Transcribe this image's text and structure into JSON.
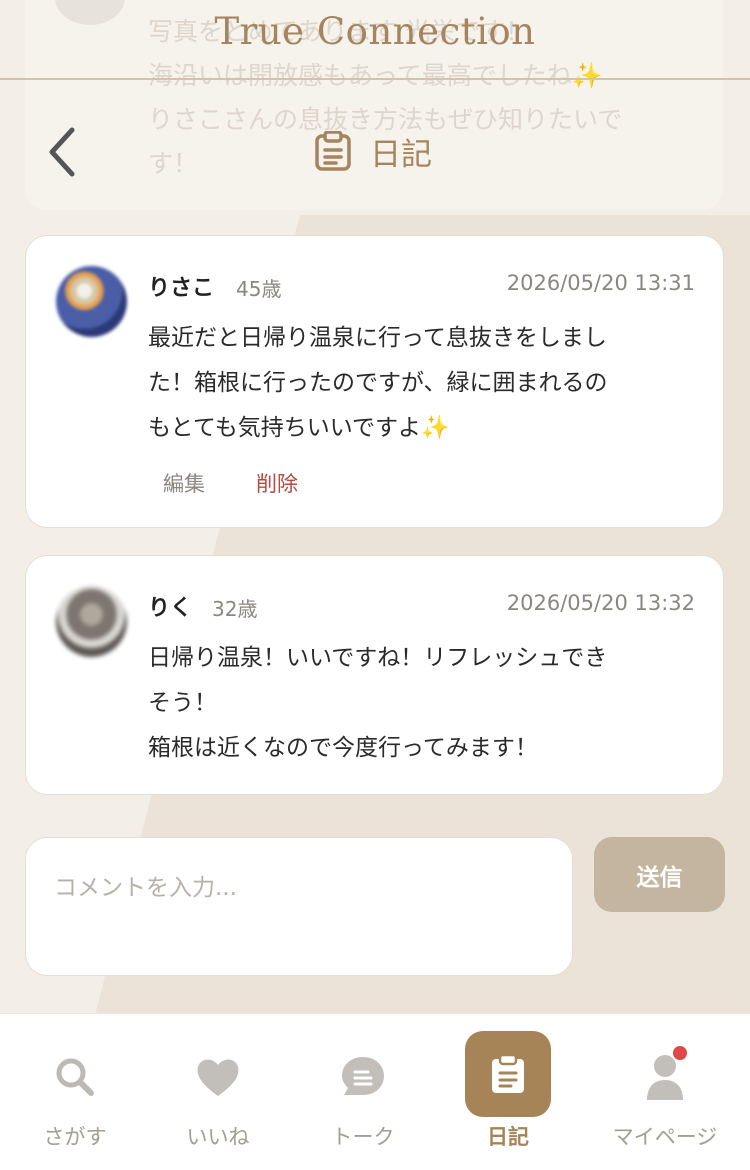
{
  "header": {
    "brand": "True Connection",
    "page_title": "日記"
  },
  "ghost_comment": {
    "text": "写真をとめてあります 光栄です！\n海沿いは開放感もあって最高でしたね✨\nりさこさんの息抜き方法もぜひ知りたいで\nす！"
  },
  "comments": [
    {
      "name": "りさこ",
      "age": "45歳",
      "timestamp": "2026/05/20 13:31",
      "text": "最近だと日帰り温泉に行って息抜きをしまし\nた！箱根に行ったのですが、緑に囲まれるの\nもとても気持ちいいですよ✨",
      "edit_label": "編集",
      "delete_label": "削除"
    },
    {
      "name": "りく",
      "age": "32歳",
      "timestamp": "2026/05/20 13:32",
      "text": "日帰り温泉！いいですね！リフレッシュでき\nそう！\n箱根は近くなので今度行ってみます！"
    }
  ],
  "composer": {
    "placeholder": "コメントを入力...",
    "send_label": "送信"
  },
  "nav": {
    "items": [
      {
        "label": "さがす",
        "icon": "search-icon"
      },
      {
        "label": "いいね",
        "icon": "heart-icon"
      },
      {
        "label": "トーク",
        "icon": "chat-icon"
      },
      {
        "label": "日記",
        "icon": "clipboard-icon",
        "active": true
      },
      {
        "label": "マイページ",
        "icon": "user-icon",
        "has_badge": true
      }
    ]
  },
  "colors": {
    "accent": "#a68457",
    "background": "#f3efe8",
    "delete": "#b54a3e",
    "badge": "#e04848"
  }
}
